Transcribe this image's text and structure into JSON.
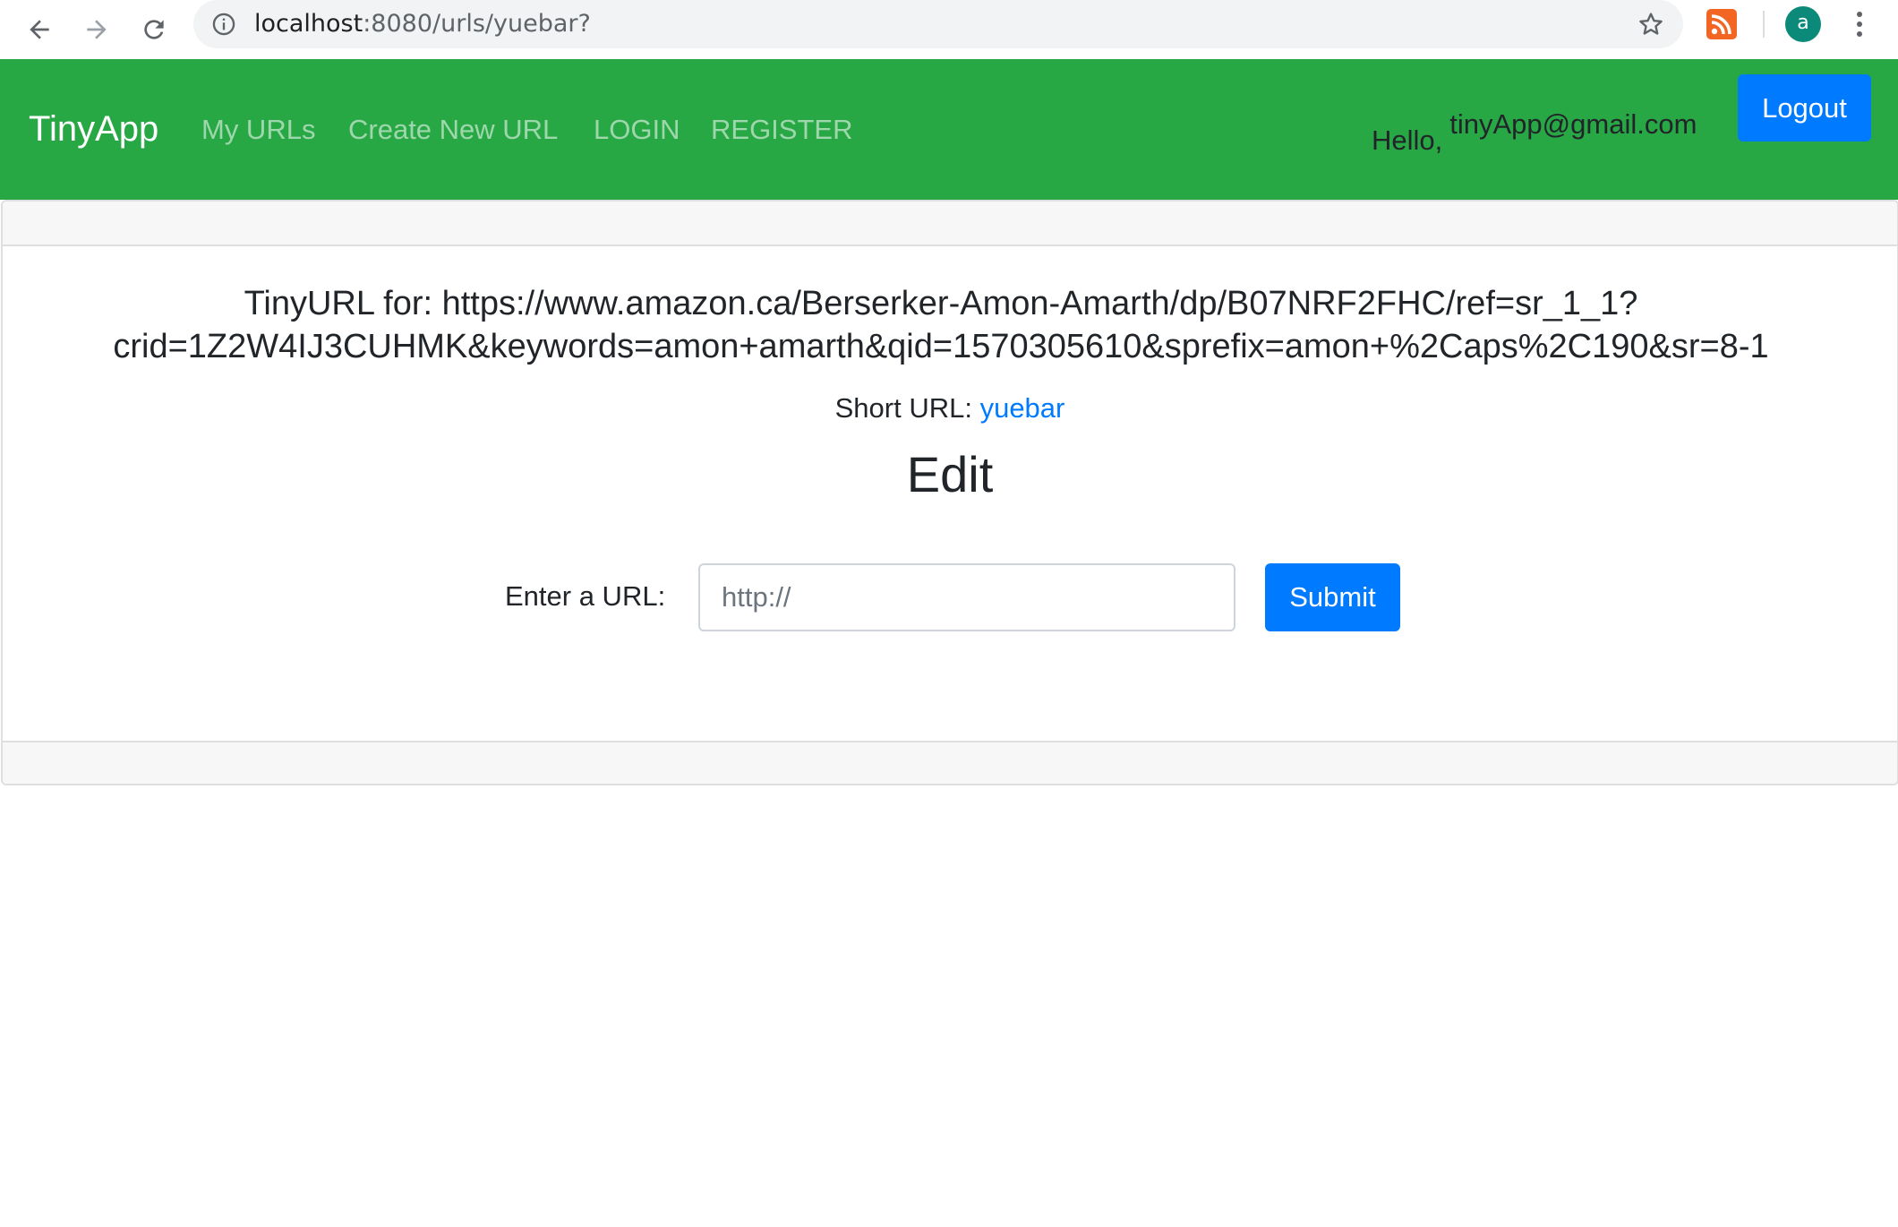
{
  "browser": {
    "url_host": "localhost",
    "url_rest": ":8080/urls/yuebar?",
    "profile_initial": "a",
    "icons": {
      "back": "arrow-left-icon",
      "forward": "arrow-right-icon",
      "reload": "reload-icon",
      "info": "info-icon",
      "bookmark": "star-icon",
      "extension": "rss-icon",
      "menu": "kebab-menu-icon"
    }
  },
  "navbar": {
    "brand": "TinyApp",
    "links": [
      {
        "label": "My URLs"
      },
      {
        "label": "Create New URL"
      },
      {
        "label": "LOGIN"
      },
      {
        "label": "REGISTER"
      }
    ],
    "greeting": "Hello,",
    "user_email": "tinyApp@gmail.com",
    "logout_label": "Logout",
    "colors": {
      "background": "#28a745",
      "logout_button": "#007bff"
    }
  },
  "main": {
    "title": "TinyURL for: https://www.amazon.ca/Berserker-Amon-Amarth/dp/B07NRF2FHC/ref=sr_1_1?crid=1Z2W4IJ3CUHMK&keywords=amon+amarth&qid=1570305610&sprefix=amon+%2Caps%2C190&sr=8-1",
    "short_url_label": "Short URL:",
    "short_url_value": "yuebar",
    "edit_heading": "Edit",
    "form": {
      "label": "Enter a URL:",
      "placeholder": "http://",
      "value": "",
      "submit_label": "Submit"
    }
  }
}
